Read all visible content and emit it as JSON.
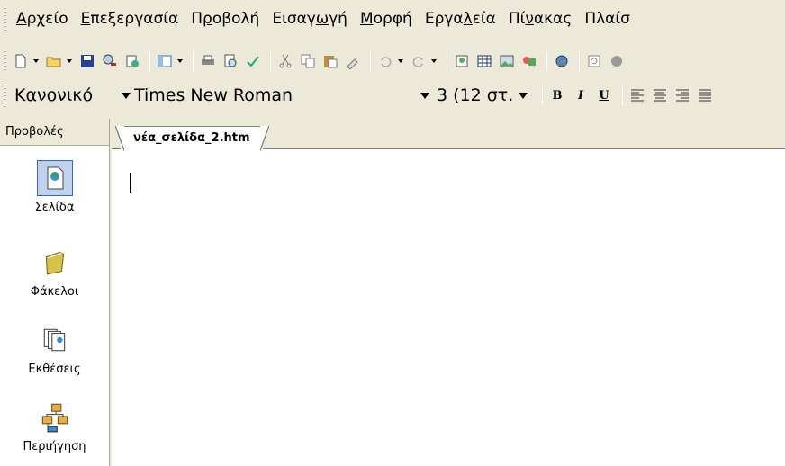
{
  "menu": [
    {
      "pre": "",
      "acc": "Α",
      "post": "ρχείο"
    },
    {
      "pre": "",
      "acc": "Ε",
      "post": "πεξεργασία"
    },
    {
      "pre": "Π",
      "acc": "ρ",
      "post": "οβολή"
    },
    {
      "pre": "Εισαγ",
      "acc": "ω",
      "post": "γή"
    },
    {
      "pre": "",
      "acc": "Μ",
      "post": "ορφή"
    },
    {
      "pre": "Εργα",
      "acc": "λ",
      "post": "εία"
    },
    {
      "pre": "Πί",
      "acc": "ν",
      "post": "ακας"
    },
    {
      "pre": "Πλαίσ",
      "acc": "",
      "post": ""
    }
  ],
  "formatting": {
    "style": "Κανονικό",
    "font": "Times New Roman",
    "size": "3  (12 στ.",
    "bold": "B",
    "italic": "I",
    "underline": "U"
  },
  "views_panel": {
    "header": "Προβολές",
    "items": {
      "page": "Σελίδα",
      "folders": "Φάκελοι",
      "reports": "Εκθέσεις",
      "navigation": "Περιήγηση"
    }
  },
  "editor": {
    "tab": "νέα_σελίδα_2.htm"
  },
  "colors": {
    "chrome": "#ece9d8",
    "selection": "#316ac5"
  }
}
